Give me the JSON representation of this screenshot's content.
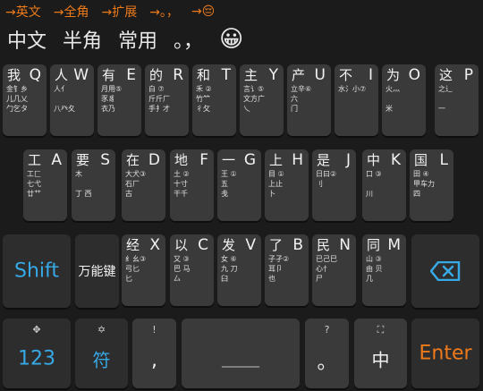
{
  "hints": [
    {
      "label": "→英文"
    },
    {
      "label": "→全角"
    },
    {
      "label": "→扩展"
    },
    {
      "label": "→。，"
    },
    {
      "label": "→😔"
    }
  ],
  "candidates": [
    {
      "label": "中文"
    },
    {
      "label": "半角"
    },
    {
      "label": "常用"
    },
    {
      "label": "。，"
    },
    {
      "label": "😀"
    }
  ],
  "rows": {
    "row1": [
      {
        "root": "我",
        "letter": "Q",
        "radicals": "金钅乡\n儿几乂\n勹乞タ"
      },
      {
        "root": "人",
        "letter": "W",
        "radicals": "人亻\n\n八癶夂"
      },
      {
        "root": "有",
        "letter": "E",
        "radicals": "月用⑤\n豕豸\n衣乃"
      },
      {
        "root": "的",
        "letter": "R",
        "radicals": "白 ⑦\n斤斤厂\n手扌才"
      },
      {
        "root": "和",
        "letter": "T",
        "radicals": "禾 ②\n竹⺮\n彳攵"
      },
      {
        "root": "主",
        "letter": "Y",
        "radicals": "言讠⑤\n文方广\n乀"
      },
      {
        "root": "产",
        "letter": "U",
        "radicals": "立辛⑥\n六\n门"
      },
      {
        "root": "不",
        "letter": "I",
        "radicals": "水氵小⑦\n\n"
      },
      {
        "root": "为",
        "letter": "O",
        "radicals": "火灬\n\n米"
      },
      {
        "root": "这",
        "letter": "P",
        "radicals": "之辶\n\n一"
      }
    ],
    "row2": [
      {
        "root": "工",
        "letter": "A",
        "radicals": "工匚\n七弋\n廿艹"
      },
      {
        "root": "要",
        "letter": "S",
        "radicals": "木\n\n丁 西"
      },
      {
        "root": "在",
        "letter": "D",
        "radicals": "大犬③\n石厂\n古"
      },
      {
        "root": "地",
        "letter": "F",
        "radicals": "土 ②\n十寸\n干千"
      },
      {
        "root": "一",
        "letter": "G",
        "radicals": "王 ①\n五\n戋"
      },
      {
        "root": "上",
        "letter": "H",
        "radicals": "目 ①\n上止\n卜"
      },
      {
        "root": "是",
        "letter": "J",
        "radicals": "日曰②\n刂\n"
      },
      {
        "root": "中",
        "letter": "K",
        "radicals": "口 ③\n\n川"
      },
      {
        "root": "国",
        "letter": "L",
        "radicals": "田 ④\n甲车力\n四"
      }
    ],
    "row3": [
      {
        "root": "经",
        "letter": "X",
        "radicals": "纟幺③\n弓匕\n匕"
      },
      {
        "root": "以",
        "letter": "C",
        "radicals": "又 ③\n巴 马\n厶"
      },
      {
        "root": "发",
        "letter": "V",
        "radicals": "女 ⑥\n九 刀\n臼"
      },
      {
        "root": "了",
        "letter": "B",
        "radicals": "子孑②\n耳卩\n也"
      },
      {
        "root": "民",
        "letter": "N",
        "radicals": "已己巳\n心忄\n尸"
      },
      {
        "root": "同",
        "letter": "M",
        "radicals": "山 ③\n由 贝\n几"
      }
    ]
  },
  "special": {
    "shift": "Shift",
    "universal": "万能键",
    "num_top": "✥",
    "num": "123",
    "sym_top": "✡",
    "sym": "符",
    "comma_top": "!",
    "comma": ",",
    "space": "______",
    "period_top": "?",
    "period": "。",
    "zhong_top": "⛶",
    "zhong": "中",
    "enter": "Enter"
  },
  "colors": {
    "accent_blue": "#37a9e6",
    "accent_orange": "#ef7a1a"
  }
}
